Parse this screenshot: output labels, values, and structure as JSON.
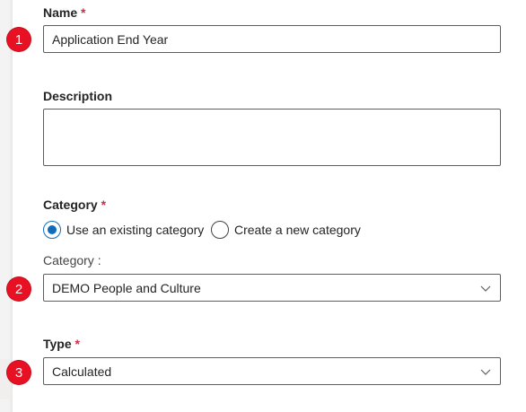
{
  "name": {
    "label": "Name",
    "required_mark": "*",
    "value": "Application End Year"
  },
  "description": {
    "label": "Description",
    "value": ""
  },
  "category": {
    "label": "Category",
    "required_mark": "*",
    "options": [
      {
        "label": "Use an existing category",
        "selected": true
      },
      {
        "label": "Create a new category",
        "selected": false
      }
    ],
    "select_label": "Category :",
    "select_value": "DEMO People and Culture"
  },
  "type": {
    "label": "Type",
    "required_mark": "*",
    "value": "Calculated"
  },
  "badges": [
    "1",
    "2",
    "3"
  ],
  "colors": {
    "badge": "#e81123",
    "required": "#c4314b",
    "radio_accent": "#0f6cbd"
  }
}
